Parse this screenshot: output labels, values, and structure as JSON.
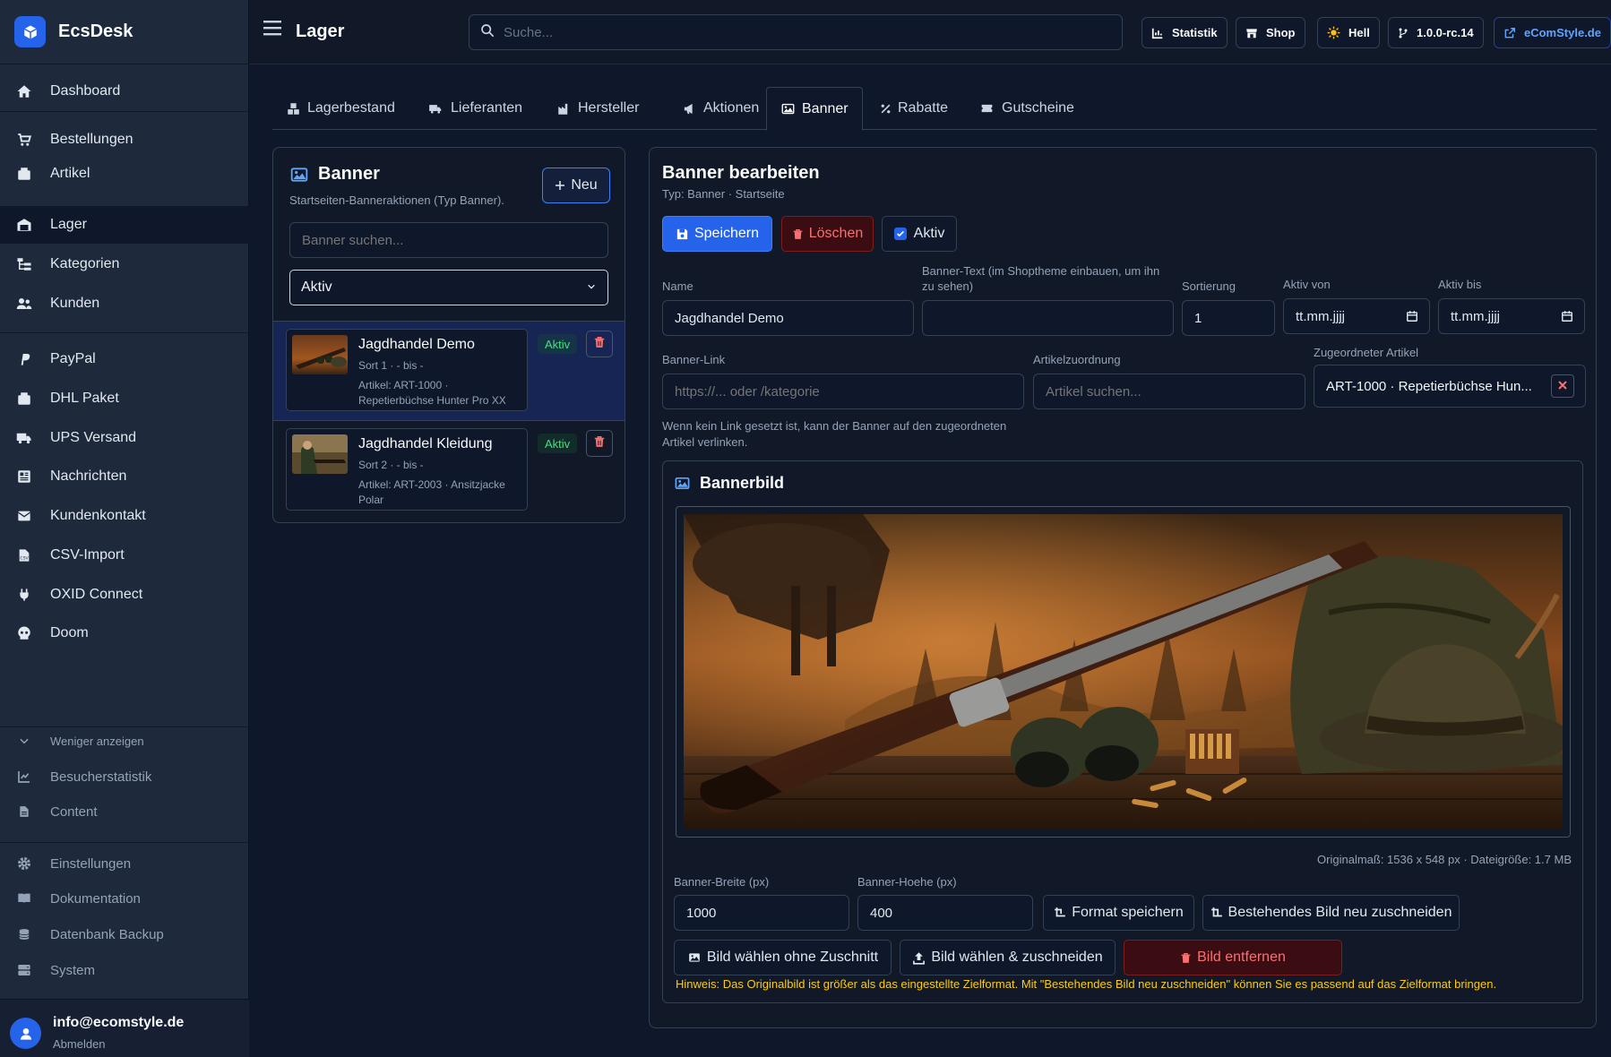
{
  "app": {
    "name": "EcsDesk",
    "brand_color": "#2563eb"
  },
  "sidebar": {
    "items": [
      {
        "label": "Dashboard",
        "icon": "home-icon"
      },
      {
        "label": "Bestellungen",
        "icon": "cart-icon"
      },
      {
        "label": "Artikel",
        "icon": "box-icon"
      },
      {
        "label": "Lager",
        "icon": "warehouse-icon",
        "active": true
      },
      {
        "label": "Kategorien",
        "icon": "tree-icon"
      },
      {
        "label": "Kunden",
        "icon": "users-icon"
      },
      {
        "label": "PayPal",
        "icon": "paypal-icon"
      },
      {
        "label": "DHL Paket",
        "icon": "package-icon"
      },
      {
        "label": "UPS Versand",
        "icon": "truck-icon"
      },
      {
        "label": "Nachrichten",
        "icon": "newspaper-icon"
      },
      {
        "label": "Kundenkontakt",
        "icon": "mail-icon"
      },
      {
        "label": "CSV-Import",
        "icon": "csv-file-icon"
      },
      {
        "label": "OXID Connect",
        "icon": "plug-icon"
      },
      {
        "label": "Doom",
        "icon": "skull-icon"
      }
    ],
    "toggle_label": "Weniger anzeigen",
    "more_items": [
      {
        "label": "Besucherstatistik",
        "icon": "chart-icon"
      },
      {
        "label": "Content",
        "icon": "file-icon"
      }
    ],
    "settings_items": [
      {
        "label": "Einstellungen",
        "icon": "gear-icon"
      },
      {
        "label": "Dokumentation",
        "icon": "book-icon"
      },
      {
        "label": "Datenbank Backup",
        "icon": "database-icon"
      },
      {
        "label": "System",
        "icon": "server-icon"
      }
    ],
    "user": {
      "email": "info@ecomstyle.de",
      "logout": "Abmelden"
    }
  },
  "header": {
    "title": "Lager",
    "search_placeholder": "Suche...",
    "buttons": [
      {
        "label": "Statistik",
        "icon": "chart-icon"
      },
      {
        "label": "Shop",
        "icon": "store-icon"
      },
      {
        "label": "Hell",
        "icon": "sun-icon"
      },
      {
        "label": "1.0.0-rc.14",
        "icon": "branch-icon"
      },
      {
        "label": "eComStyle.de",
        "icon": "external-link-icon"
      }
    ]
  },
  "tabs": [
    {
      "label": "Lagerbestand",
      "icon": "boxes-icon"
    },
    {
      "label": "Lieferanten",
      "icon": "truck-icon"
    },
    {
      "label": "Hersteller",
      "icon": "factory-icon"
    },
    {
      "label": "Aktionen",
      "icon": "megaphone-icon"
    },
    {
      "label": "Banner",
      "icon": "image-icon",
      "active": true
    },
    {
      "label": "Rabatte",
      "icon": "percent-icon"
    },
    {
      "label": "Gutscheine",
      "icon": "ticket-icon"
    }
  ],
  "banner_list": {
    "title": "Banner",
    "subtitle": "Startseiten-Banneraktionen (Typ Banner).",
    "new_label": "Neu",
    "search_placeholder": "Banner suchen...",
    "filter_value": "Aktiv",
    "items": [
      {
        "title": "Jagdhandel Demo",
        "meta": "Sort 1 · - bis -",
        "article": "Artikel: ART-1000 · Repetierbüchse Hunter Pro XX",
        "status": "Aktiv",
        "selected": true
      },
      {
        "title": "Jagdhandel Kleidung",
        "meta": "Sort 2 · - bis -",
        "article": "Artikel: ART-2003 · Ansitzjacke Polar",
        "status": "Aktiv",
        "selected": false
      }
    ]
  },
  "editor": {
    "title": "Banner bearbeiten",
    "subtitle": "Typ: Banner · Startseite",
    "save_label": "Speichern",
    "delete_label": "Löschen",
    "active_label": "Aktiv",
    "active_checked": true,
    "fields": {
      "name_label": "Name",
      "name_value": "Jagdhandel Demo",
      "text_label": "Banner-Text (im Shoptheme einbauen, um ihn zu sehen)",
      "text_value": "",
      "sort_label": "Sortierung",
      "sort_value": "1",
      "from_label": "Aktiv von",
      "from_placeholder": "tt.mm.jjjj",
      "to_label": "Aktiv bis",
      "to_placeholder": "tt.mm.jjjj",
      "link_label": "Banner-Link",
      "link_placeholder": "https://... oder /kategorie",
      "assign_label": "Artikelzuordnung",
      "assign_placeholder": "Artikel suchen...",
      "assigned_label": "Zugeordneter Artikel",
      "assigned_value": "ART-1000 · Repetierbüchse Hun..."
    },
    "link_hint": "Wenn kein Link gesetzt ist, kann der Banner auf den zugeordneten Artikel verlinken.",
    "image": {
      "title": "Bannerbild",
      "meta": "Originalmaß: 1536 x 548 px · Dateigröße: 1.7 MB",
      "width_label": "Banner-Breite (px)",
      "width_value": "1000",
      "height_label": "Banner-Hoehe (px)",
      "height_value": "400",
      "save_format": "Format speichern",
      "recrop": "Bestehendes Bild neu zuschneiden",
      "choose_nocrop": "Bild wählen ohne Zuschnitt",
      "choose_crop": "Bild wählen & zuschneiden",
      "remove": "Bild entfernen",
      "warning": "Hinweis: Das Originalbild ist größer als das eingestellte Zielformat. Mit \"Bestehendes Bild neu zuschneiden\" können Sie es passend auf das Zielformat bringen."
    }
  }
}
